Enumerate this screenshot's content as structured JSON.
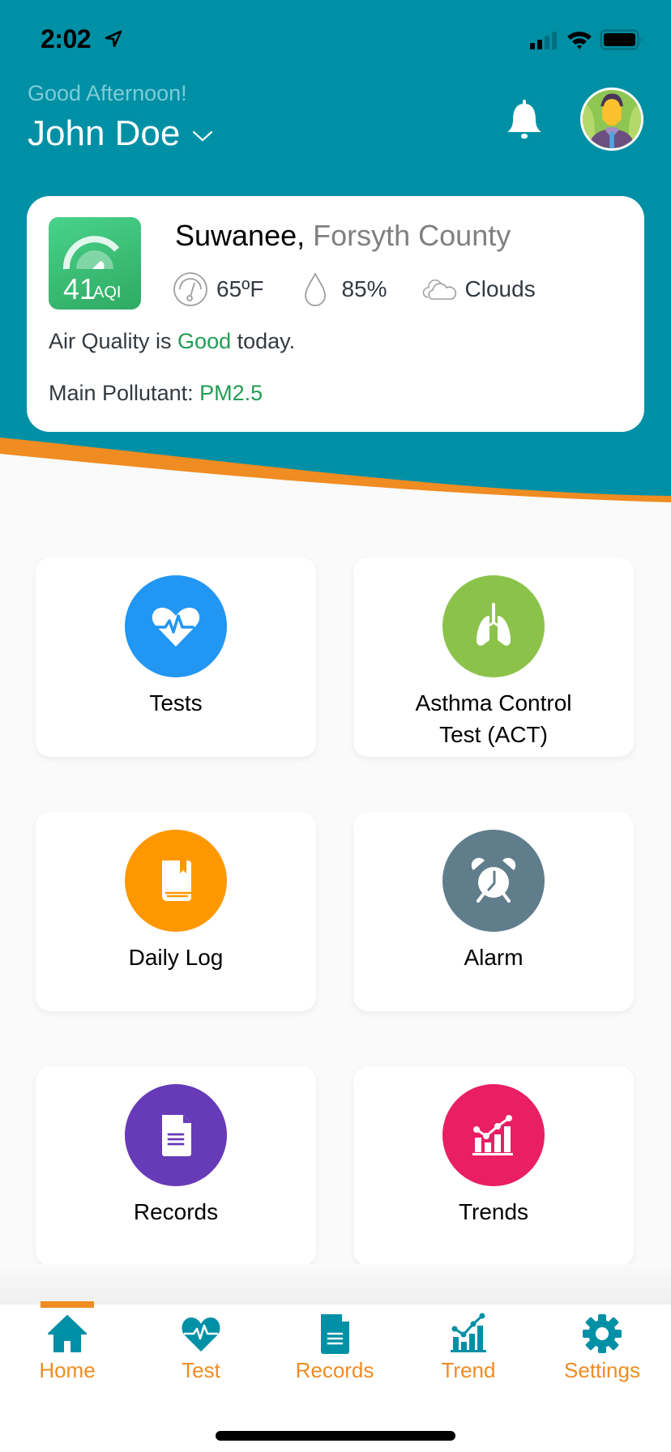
{
  "colors": {
    "header_teal": "#0090a6",
    "wave_orange": "#ef8c22",
    "good_green": "#229c55",
    "nav_teal": "#0090a6",
    "nav_label_orange": "#ef8c22"
  },
  "status_bar": {
    "time": "2:02",
    "icons": [
      "location-arrow-icon",
      "signal-icon",
      "wifi-icon",
      "battery-icon"
    ]
  },
  "header": {
    "greeting": "Good Afternoon!",
    "user_name": "John Doe",
    "icons": [
      "chevron-down-icon",
      "bell-icon",
      "avatar"
    ]
  },
  "aqi_card": {
    "aqi_value": "41",
    "aqi_unit": "AQI",
    "city": "Suwanee,",
    "county": "Forsyth County",
    "temperature": "65ºF",
    "humidity": "85%",
    "condition": "Clouds",
    "air_quality_prefix": "Air Quality is ",
    "air_quality_status": "Good",
    "air_quality_suffix": " today.",
    "pollutant_label": "Main Pollutant: ",
    "pollutant_value": "PM2.5"
  },
  "tiles": [
    {
      "label": "Tests",
      "icon": "heart-pulse-icon",
      "color": "#2196f3"
    },
    {
      "label": "Asthma Control\nTest (ACT)",
      "icon": "lungs-icon",
      "color": "#8bc34a"
    },
    {
      "label": "Daily Log",
      "icon": "book-icon",
      "color": "#ff9800"
    },
    {
      "label": "Alarm",
      "icon": "alarm-clock-icon",
      "color": "#607d8b"
    },
    {
      "label": "Records",
      "icon": "document-icon",
      "color": "#673ab7"
    },
    {
      "label": "Trends",
      "icon": "chart-trend-icon",
      "color": "#e91e63"
    }
  ],
  "bottom_nav": {
    "active": "Home",
    "items": [
      {
        "label": "Home",
        "icon": "home-icon"
      },
      {
        "label": "Test",
        "icon": "heart-pulse-icon"
      },
      {
        "label": "Records",
        "icon": "document-icon"
      },
      {
        "label": "Trend",
        "icon": "chart-trend-icon"
      },
      {
        "label": "Settings",
        "icon": "gear-icon"
      }
    ]
  }
}
